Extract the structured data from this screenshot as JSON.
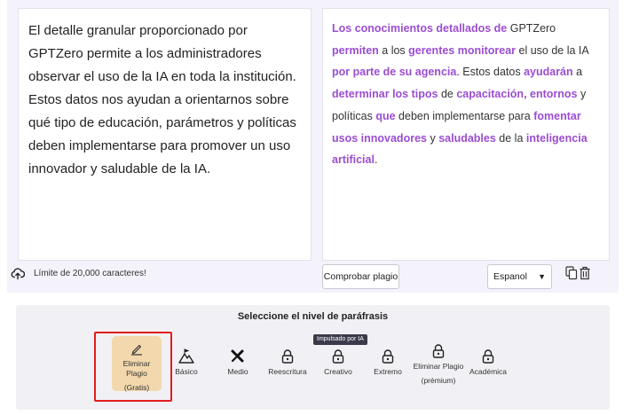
{
  "editor": {
    "input_text": "El detalle granular proporcionado por GPTZero permite a los administradores observar el uso de la IA en toda la institución. Estos datos nos ayudan a orientarnos sobre qué tipo de educación, parámetros y políticas deben implementarse para promover un uso innovador y saludable de la IA.",
    "output_segments": [
      {
        "text": "Los conocimientos detallados de",
        "highlight": true
      },
      {
        "text": " GPTZero ",
        "highlight": false
      },
      {
        "text": "permiten",
        "highlight": true
      },
      {
        "text": " a los ",
        "highlight": false
      },
      {
        "text": "gerentes monitorear",
        "highlight": true
      },
      {
        "text": " el uso de la IA ",
        "highlight": false
      },
      {
        "text": "por parte de su agencia",
        "highlight": true
      },
      {
        "text": ". Estos datos ",
        "highlight": false
      },
      {
        "text": "ayudarán",
        "highlight": true
      },
      {
        "text": " a ",
        "highlight": false
      },
      {
        "text": "determinar los tipos",
        "highlight": true
      },
      {
        "text": " de ",
        "highlight": false
      },
      {
        "text": "capacitación, entornos",
        "highlight": true
      },
      {
        "text": " y políticas ",
        "highlight": false
      },
      {
        "text": "que",
        "highlight": true
      },
      {
        "text": " deben implementarse para ",
        "highlight": false
      },
      {
        "text": "fomentar usos innovadores",
        "highlight": true
      },
      {
        "text": " y ",
        "highlight": false
      },
      {
        "text": "saludables",
        "highlight": true
      },
      {
        "text": " de la ",
        "highlight": false
      },
      {
        "text": "inteligencia artificial",
        "highlight": true
      },
      {
        "text": ".",
        "highlight": false
      }
    ],
    "highlight_color": "#9b4dd1",
    "char_limit_label": "Límite de 20,000 caracteres!",
    "check_button_label": "Comprobar plagio",
    "language_selected": "Espanol"
  },
  "levels": {
    "title": "Seleccione el nivel de paráfrasis",
    "premium_badge": "Impulsado por IA",
    "free": {
      "label": "Eliminar Plagio",
      "sub": "(Gratis)"
    },
    "basic": {
      "label": "Básico"
    },
    "medium": {
      "label": "Medio"
    },
    "rewrite": {
      "label": "Reescritura"
    },
    "creative": {
      "label": "Creativo"
    },
    "extreme": {
      "label": "Extremo"
    },
    "premium": {
      "label": "Eliminar Plagio",
      "sub": "(prèmium)"
    },
    "academic": {
      "label": "Académica"
    },
    "selected_color": "#f2d8ac",
    "outline_color": "#e01d1d"
  }
}
